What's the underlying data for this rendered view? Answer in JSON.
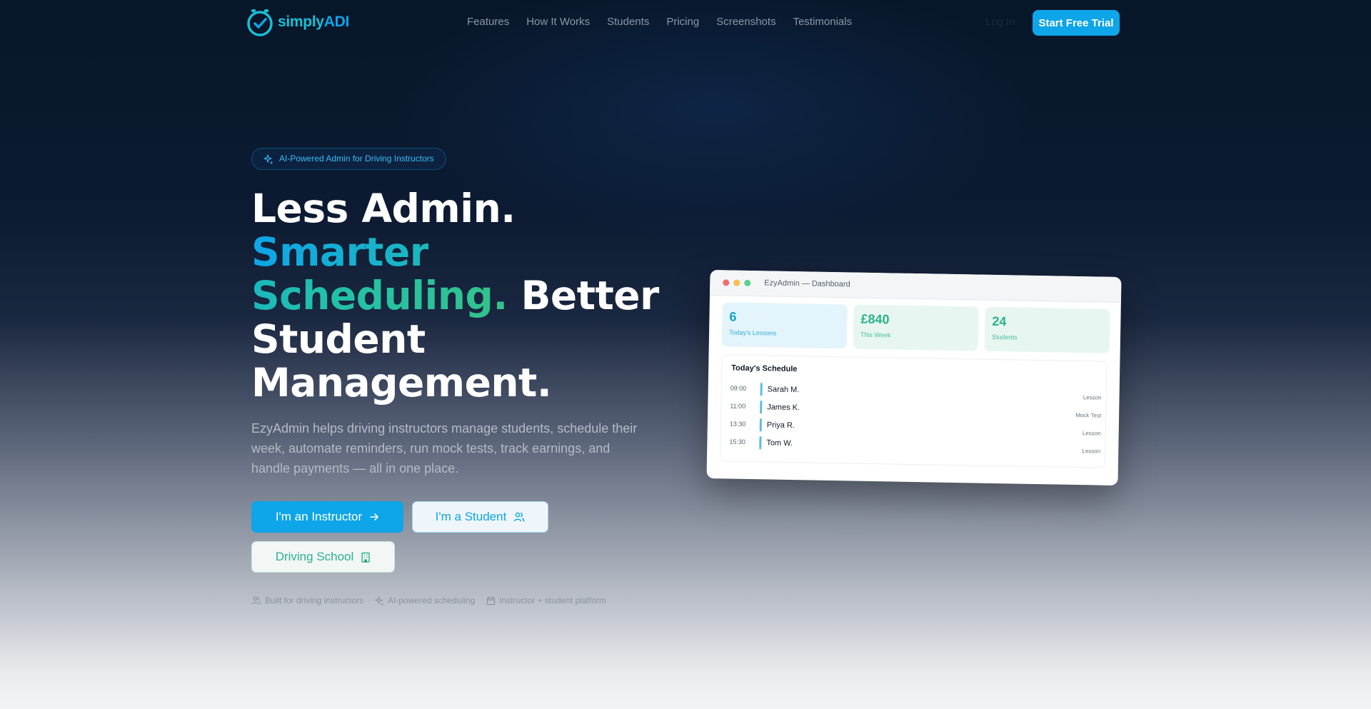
{
  "nav": {
    "logo": {
      "brand_part1": "simply",
      "brand_part2": "ADI"
    },
    "links": [
      "Features",
      "How It Works",
      "Students",
      "Pricing",
      "Screenshots",
      "Testimonials"
    ],
    "login": "Log In",
    "cta": "Start Free Trial"
  },
  "hero": {
    "badge": "AI-Powered Admin for Driving Instructors",
    "headline": {
      "line1": "Less Admin.",
      "accent": "Smarter Scheduling.",
      "rest": "Better Student Management."
    },
    "description": "EzyAdmin helps driving instructors manage students, schedule their week, automate reminders, run mock tests, track earnings, and handle payments — all in one place.",
    "buttons": {
      "instructor": "I'm an Instructor",
      "student": "I'm a Student",
      "school": "Driving School"
    },
    "features": [
      "Built for driving instructors",
      "AI-powered scheduling",
      "Instructor + student platform"
    ]
  },
  "dashboard": {
    "window_title": "EzyAdmin — Dashboard",
    "stats": [
      {
        "value": "6",
        "label": "Today's Lessons"
      },
      {
        "value": "£840",
        "label": "This Week"
      },
      {
        "value": "24",
        "label": "Students"
      }
    ],
    "schedule_title": "Today's Schedule",
    "schedule": [
      {
        "time": "09:00",
        "name": "Sarah M.",
        "type": "Lesson"
      },
      {
        "time": "11:00",
        "name": "James K.",
        "type": "Mock Test"
      },
      {
        "time": "13:30",
        "name": "Priya R.",
        "type": "Lesson"
      },
      {
        "time": "15:30",
        "name": "Tom W.",
        "type": "Lesson"
      }
    ]
  },
  "colors": {
    "primary": "#0ea5e9",
    "accent_green": "#2bb38a",
    "background_top": "#081629"
  }
}
